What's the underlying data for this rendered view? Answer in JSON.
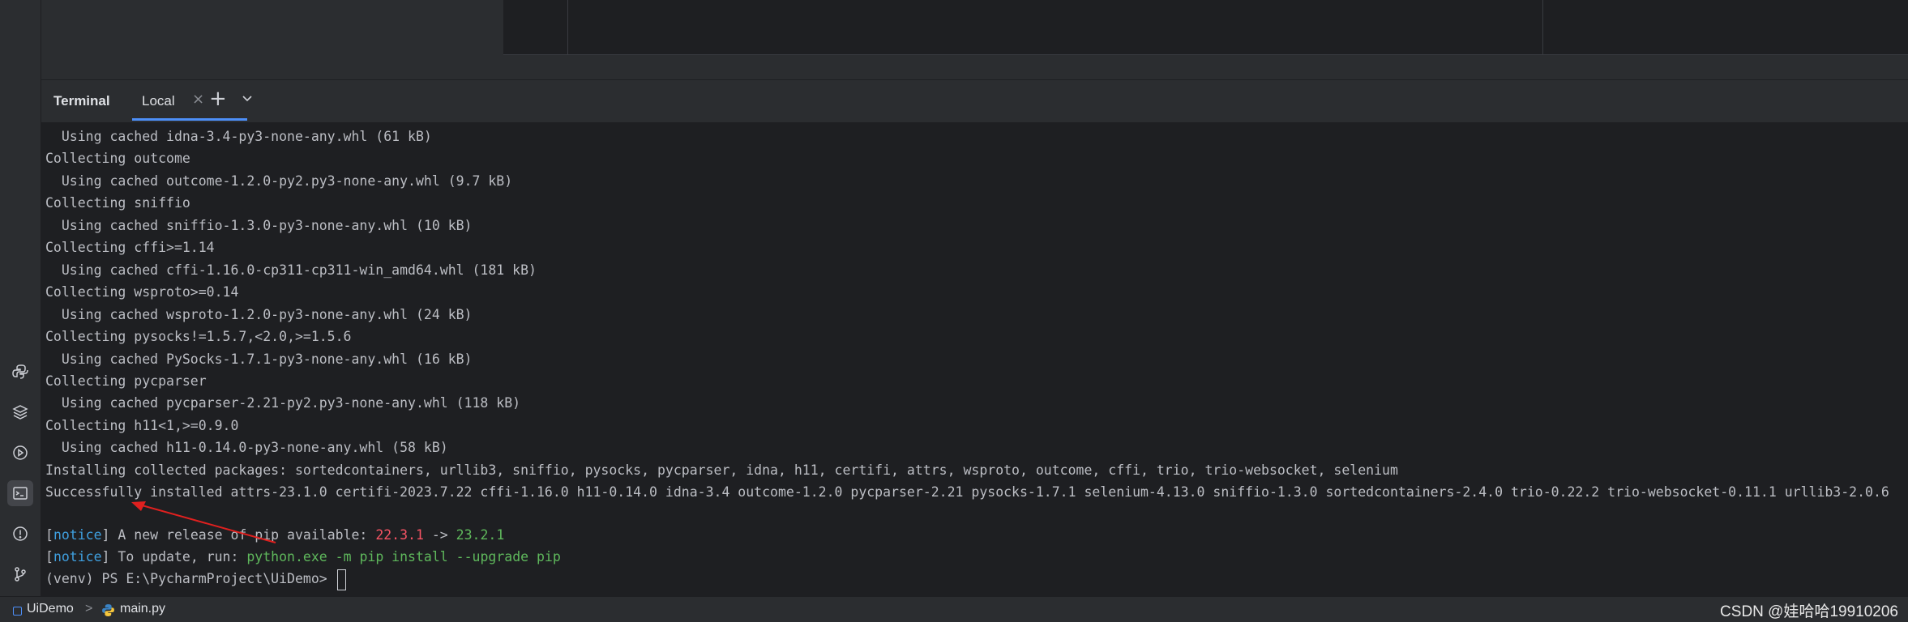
{
  "terminal": {
    "title": "Terminal",
    "tab_label": "Local",
    "close_glyph": "×",
    "add_glyph": "+",
    "lines": [
      {
        "text": "  Using cached idna-3.4-py3-none-any.whl (61 kB)"
      },
      {
        "text": "Collecting outcome"
      },
      {
        "text": "  Using cached outcome-1.2.0-py2.py3-none-any.whl (9.7 kB)"
      },
      {
        "text": "Collecting sniffio"
      },
      {
        "text": "  Using cached sniffio-1.3.0-py3-none-any.whl (10 kB)"
      },
      {
        "text": "Collecting cffi>=1.14"
      },
      {
        "text": "  Using cached cffi-1.16.0-cp311-cp311-win_amd64.whl (181 kB)"
      },
      {
        "text": "Collecting wsproto>=0.14"
      },
      {
        "text": "  Using cached wsproto-1.2.0-py3-none-any.whl (24 kB)"
      },
      {
        "text": "Collecting pysocks!=1.5.7,<2.0,>=1.5.6"
      },
      {
        "text": "  Using cached PySocks-1.7.1-py3-none-any.whl (16 kB)"
      },
      {
        "text": "Collecting pycparser"
      },
      {
        "text": "  Using cached pycparser-2.21-py2.py3-none-any.whl (118 kB)"
      },
      {
        "text": "Collecting h11<1,>=0.9.0"
      },
      {
        "text": "  Using cached h11-0.14.0-py3-none-any.whl (58 kB)"
      },
      {
        "text": "Installing collected packages: sortedcontainers, urllib3, sniffio, pysocks, pycparser, idna, h11, certifi, attrs, wsproto, outcome, cffi, trio, trio-websocket, selenium"
      },
      {
        "text": "Successfully installed attrs-23.1.0 certifi-2023.7.22 cffi-1.16.0 h11-0.14.0 idna-3.4 outcome-1.2.0 pycparser-2.21 pysocks-1.7.1 selenium-4.13.0 sniffio-1.3.0 sortedcontainers-2.4.0 trio-0.22.2 trio-websocket-0.11.1 urllib3-2.0.6"
      },
      {
        "text": ""
      }
    ],
    "notice1": {
      "open": "[",
      "tag": "notice",
      "close": "]",
      "message": " A new release of pip available: ",
      "old_version": "22.3.1",
      "arrow": " -> ",
      "new_version": "23.2.1"
    },
    "notice2": {
      "open": "[",
      "tag": "notice",
      "close": "]",
      "message": " To update, run: ",
      "command": "python.exe -m pip install --upgrade pip"
    },
    "prompt": "(venv) PS E:\\PycharmProject\\UiDemo> "
  },
  "statusbar": {
    "project": "UiDemo",
    "separator": ">",
    "file": "main.py",
    "watermark": "CSDN @娃哈哈19910206"
  },
  "sidebar_icons": [
    "python-console-icon",
    "layers-icon",
    "services-icon",
    "terminal-icon",
    "problems-icon",
    "git-icon"
  ],
  "colors": {
    "notice": "#3fa0e0",
    "old_version": "#f75464",
    "new_version": "#5fb85c",
    "tab_underline": "#4d8ff8"
  }
}
